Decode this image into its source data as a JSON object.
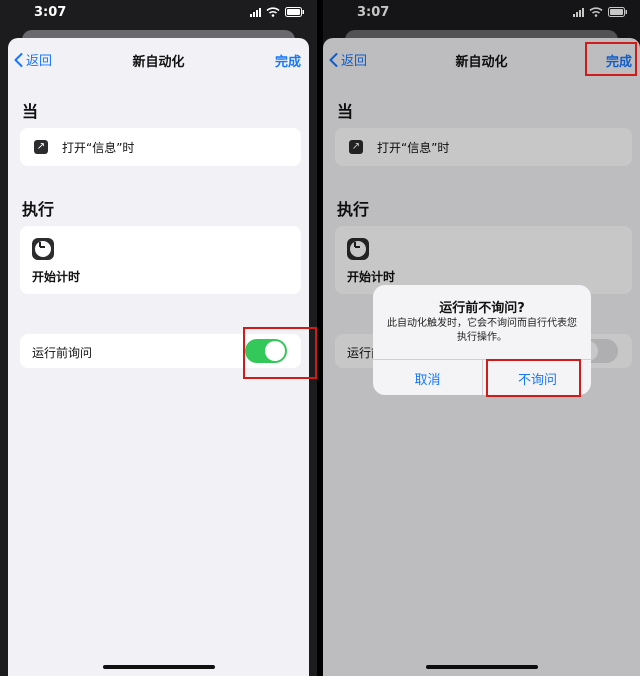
{
  "left": {
    "status": {
      "time": "3:07"
    },
    "nav": {
      "back": "返回",
      "title": "新自动化",
      "done": "完成"
    },
    "when": {
      "heading": "当",
      "trigger": "打开“信息”时"
    },
    "do": {
      "heading": "执行",
      "action": "开始计时"
    },
    "ask_before_running": {
      "label": "运行前询问",
      "on": true
    }
  },
  "right": {
    "status": {
      "time": "3:07"
    },
    "nav": {
      "back": "返回",
      "title": "新自动化",
      "done": "完成"
    },
    "when": {
      "heading": "当",
      "trigger": "打开“信息”时"
    },
    "do": {
      "heading": "执行",
      "action": "开始计时"
    },
    "ask_before_running": {
      "label": "运行前询问"
    },
    "alert": {
      "title": "运行前不询问?",
      "message": "此自动化触发时，它会不询问而自行代表您执行操作。",
      "cancel": "取消",
      "confirm": "不询问"
    }
  },
  "colors": {
    "accent": "#1677ff",
    "toggle_on": "#34c759",
    "highlight": "#d11a1a"
  }
}
